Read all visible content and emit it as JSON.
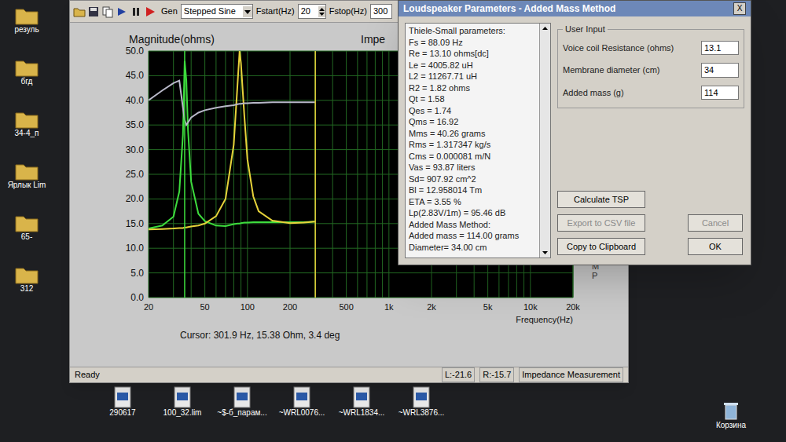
{
  "desktop": {
    "icons": [
      "резуль",
      "бгд",
      "34-4_п",
      "Ярлык Lim",
      "65-",
      "312"
    ],
    "files": [
      "290617",
      "100_32.lim",
      "~$-б_парам...",
      "~WRL0076...",
      "~WRL1834...",
      "~WRL3876..."
    ],
    "recycle_bin": "Корзина"
  },
  "main_window": {
    "toolbar": {
      "gen_label": "Gen",
      "gen_value": "Stepped Sine",
      "fstart_label": "Fstart(Hz)",
      "fstart_value": "20",
      "fstop_label": "Fstop(Hz)",
      "fstop_value": "300"
    },
    "chart": {
      "y_title": "Magnitude(ohms)",
      "title": "Impe",
      "y_ticks": [
        "50.0",
        "45.0",
        "40.0",
        "35.0",
        "30.0",
        "25.0",
        "20.0",
        "15.0",
        "10.0",
        "5.0",
        "0.0"
      ],
      "x_ticks": [
        {
          "label": "20",
          "hz": 20
        },
        {
          "label": "50",
          "hz": 50
        },
        {
          "label": "100",
          "hz": 100
        },
        {
          "label": "200",
          "hz": 200
        },
        {
          "label": "500",
          "hz": 500
        },
        {
          "label": "1k",
          "hz": 1000
        },
        {
          "label": "2k",
          "hz": 2000
        },
        {
          "label": "5k",
          "hz": 5000
        },
        {
          "label": "10k",
          "hz": 10000
        },
        {
          "label": "20k",
          "hz": 20000
        }
      ],
      "x_title": "Frequency(Hz)",
      "side_label": "LIMP",
      "cursor": "Cursor: 301.9 Hz, 15.38 Ohm, 3.4 deg",
      "frequencies": [
        20,
        25,
        30,
        33,
        35,
        36,
        37,
        38,
        40,
        45,
        50,
        60,
        70,
        80,
        85,
        88,
        90,
        95,
        100,
        110,
        120,
        150,
        200,
        250,
        300
      ],
      "series": [
        {
          "color": "#3ddc3d",
          "values": [
            14.0,
            14.6,
            16.4,
            21.5,
            33.0,
            48.0,
            44.0,
            34.0,
            23.5,
            17.0,
            15.5,
            14.6,
            14.5,
            14.9,
            15.0,
            15.0,
            15.1,
            15.2,
            15.2,
            15.3,
            15.3,
            15.3,
            15.3,
            15.3,
            15.4
          ]
        },
        {
          "color": "#e6d23a",
          "values": [
            13.8,
            13.9,
            14.0,
            14.1,
            14.1,
            14.2,
            14.2,
            14.3,
            14.4,
            14.6,
            15.0,
            16.5,
            20.0,
            31.0,
            43.0,
            50.0,
            47.5,
            37.0,
            28.0,
            20.5,
            17.5,
            15.6,
            15.1,
            15.2,
            15.4
          ]
        },
        {
          "color": "#b8b8c8",
          "values": [
            40.0,
            42.0,
            43.5,
            44.0,
            38.5,
            36.0,
            35.0,
            35.5,
            36.5,
            37.5,
            38.0,
            38.5,
            38.8,
            39.0,
            39.2,
            39.3,
            39.3,
            39.4,
            39.4,
            39.5,
            39.5,
            39.6,
            39.6,
            39.6,
            39.6
          ]
        }
      ],
      "markers": [
        {
          "hz": 36,
          "color": "#3ddc3d"
        },
        {
          "hz": 301.9,
          "color": "#e6d23a"
        }
      ]
    },
    "status_bar": {
      "text": "Ready",
      "left": "L:-21.6",
      "right": "R:-15.7",
      "mode": "Impedance Measurement"
    }
  },
  "dialog": {
    "title": "Loudspeaker Parameters - Added Mass Method",
    "close": "X",
    "results": [
      "Thiele-Small parameters:",
      "Fs = 88.09 Hz",
      "Re = 13.10 ohms[dc]",
      "Le = 4005.82 uH",
      "L2 = 11267.71 uH",
      "R2 = 1.82 ohms",
      "Qt = 1.58",
      "Qes = 1.74",
      "Qms = 16.92",
      "Mms = 40.26 grams",
      "Rms = 1.317347 kg/s",
      "Cms = 0.000081 m/N",
      "Vas = 93.87 liters",
      "Sd= 907.92 cm^2",
      "Bl = 12.958014 Tm",
      "ETA = 3.55 %",
      "Lp(2.83V/1m) = 95.46 dB",
      "Added Mass Method:",
      "Added mass = 114.00 grams",
      "Diameter= 34.00 cm"
    ],
    "group_title": "User Input",
    "fields": [
      {
        "label": "Voice coil Resistance (ohms)",
        "value": "13.1"
      },
      {
        "label": "Membrane diameter (cm)",
        "value": "34"
      },
      {
        "label": "Added mass (g)",
        "value": "114"
      }
    ],
    "buttons": [
      {
        "label": "Calculate TSP",
        "disabled": false
      },
      {
        "label": "Export to CSV file",
        "disabled": true
      },
      {
        "label": "Cancel",
        "disabled": true
      },
      {
        "label": "Copy to Clipboard",
        "disabled": false
      },
      {
        "label": "OK",
        "disabled": false
      }
    ]
  }
}
